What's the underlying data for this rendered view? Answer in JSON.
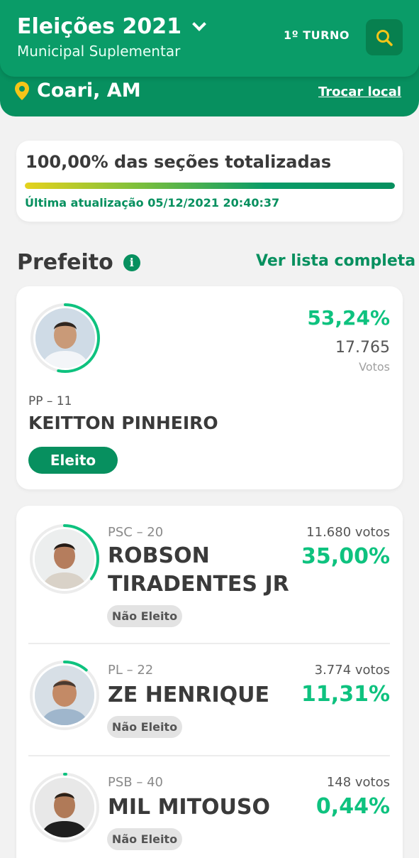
{
  "header": {
    "title": "Eleições 2021",
    "subtitle": "Municipal Suplementar",
    "turno": "1º TURNO",
    "location": "Coari, AM",
    "change_location": "Trocar local"
  },
  "progress": {
    "title": "100,00% das seções totalizadas",
    "fraction": 1.0,
    "update": "Última atualização 05/12/2021 20:40:37"
  },
  "section": {
    "title": "Prefeito",
    "see_all": "Ver lista completa"
  },
  "winner": {
    "party": "PP – 11",
    "name": "KEITTON PINHEIRO",
    "percent": "53,24%",
    "votes": "17.765",
    "votes_label": "Votos",
    "status": "Eleito",
    "share": 0.5324
  },
  "candidates": [
    {
      "party": "PSC – 20",
      "name": "ROBSON TIRADENTES JR",
      "votes": "11.680 votos",
      "percent": "35,00%",
      "status": "Não Eleito",
      "share": 0.35
    },
    {
      "party": "PL – 22",
      "name": "ZE HENRIQUE",
      "votes": "3.774 votos",
      "percent": "11,31%",
      "status": "Não Eleito",
      "share": 0.1131
    },
    {
      "party": "PSB – 40",
      "name": "MIL MITOUSO",
      "votes": "148 votos",
      "percent": "0,44%",
      "status": "Não Eleito",
      "share": 0.0044
    }
  ],
  "colors": {
    "primary": "#0a9c68",
    "primary_dark": "#07905f",
    "accent_percent": "#0ec27f",
    "pin": "#f5c518"
  },
  "icons": {
    "dropdown": "chevron-down-icon",
    "search": "search-icon",
    "location": "map-pin-icon",
    "info": "info-icon"
  }
}
